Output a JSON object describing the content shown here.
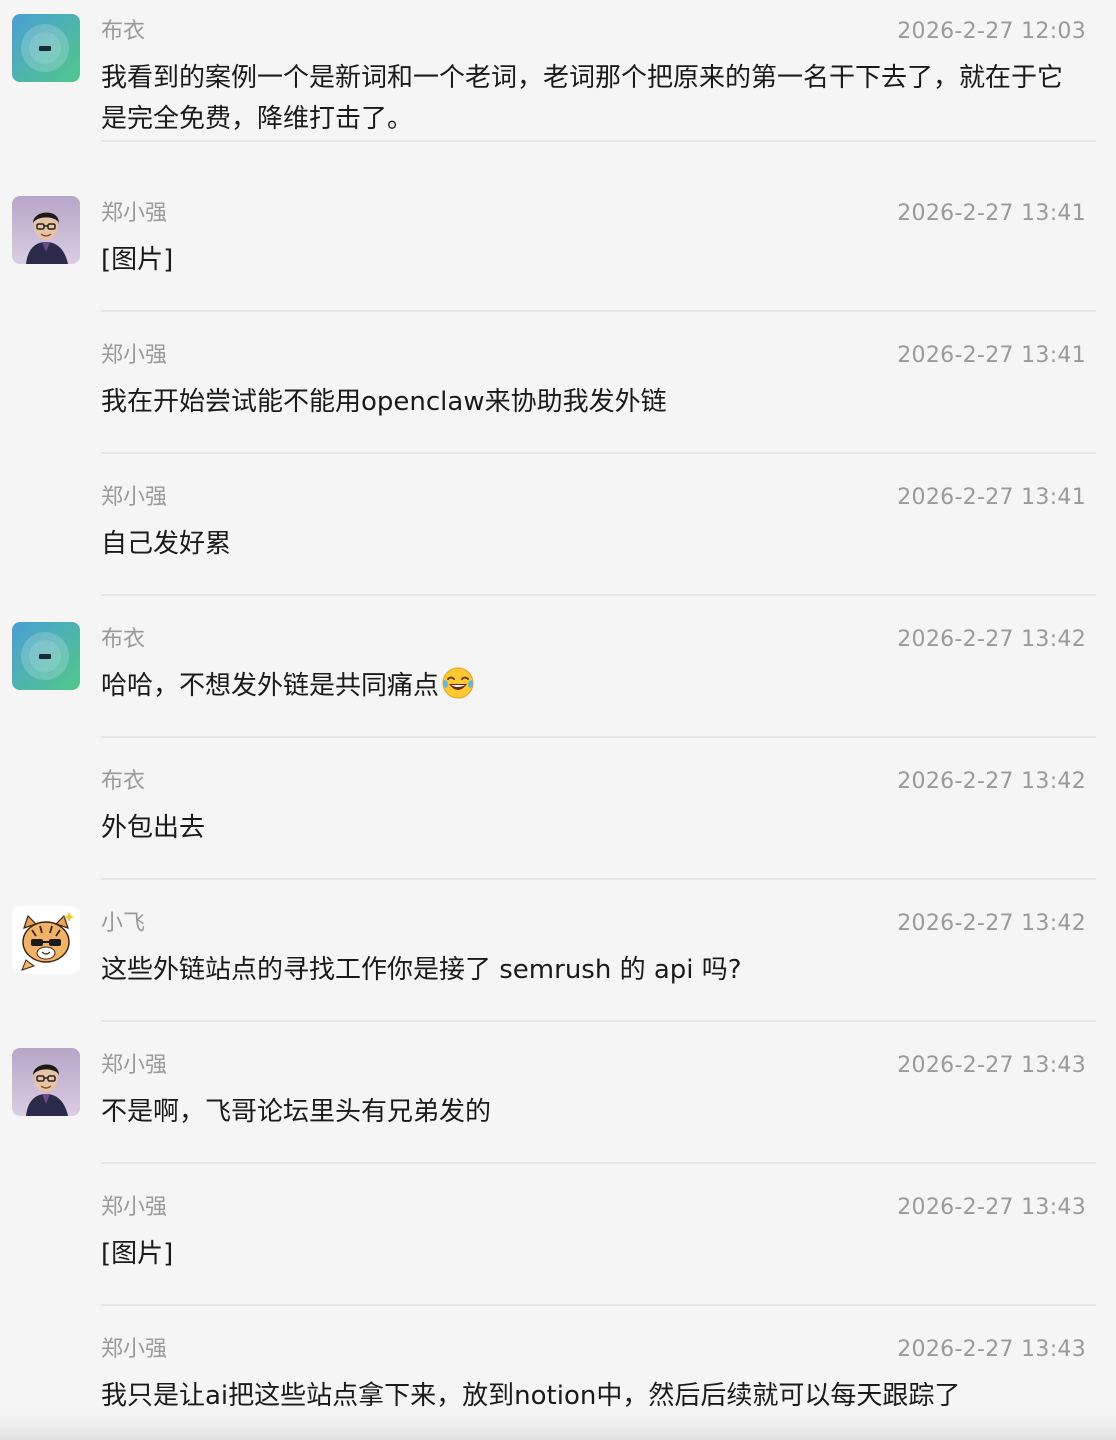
{
  "messages": [
    {
      "sender": "布衣",
      "time": "2026-2-27 12:03",
      "text": "我看到的案例一个是新词和一个老词，老词那个把原来的第一名干下去了，就在于它是完全免费，降维打击了。",
      "avatar": "buyi"
    },
    {
      "sender": "郑小强",
      "time": "2026-2-27 13:41",
      "text": "[图片]",
      "avatar": "zheng"
    },
    {
      "sender": "郑小强",
      "time": "2026-2-27 13:41",
      "text": "我在开始尝试能不能用openclaw来协助我发外链",
      "avatar": ""
    },
    {
      "sender": "郑小强",
      "time": "2026-2-27 13:41",
      "text": "自己发好累",
      "avatar": ""
    },
    {
      "sender": "布衣",
      "time": "2026-2-27 13:42",
      "text": "哈哈，不想发外链是共同痛点",
      "emoji": "tears-of-joy",
      "avatar": "buyi"
    },
    {
      "sender": "布衣",
      "time": "2026-2-27 13:42",
      "text": "外包出去",
      "avatar": ""
    },
    {
      "sender": "小飞",
      "time": "2026-2-27 13:42",
      "text": "这些外链站点的寻找工作你是接了 semrush 的 api 吗?",
      "avatar": "xiaofei"
    },
    {
      "sender": "郑小强",
      "time": "2026-2-27 13:43",
      "text": "不是啊，飞哥论坛里头有兄弟发的",
      "avatar": "zheng"
    },
    {
      "sender": "郑小强",
      "time": "2026-2-27 13:43",
      "text": "[图片]",
      "avatar": ""
    },
    {
      "sender": "郑小强",
      "time": "2026-2-27 13:43",
      "text": "我只是让ai把这些站点拿下来，放到notion中，然后后续就可以每天跟踪了",
      "avatar": ""
    }
  ],
  "colors": {
    "background": "#f5f5f5",
    "meta_text": "#9a9a9a",
    "body_text": "#1a1a1a",
    "divider": "#e6e6e6",
    "buyi_avatar_gradient": [
      "#4a9fd4",
      "#52c78a"
    ]
  }
}
